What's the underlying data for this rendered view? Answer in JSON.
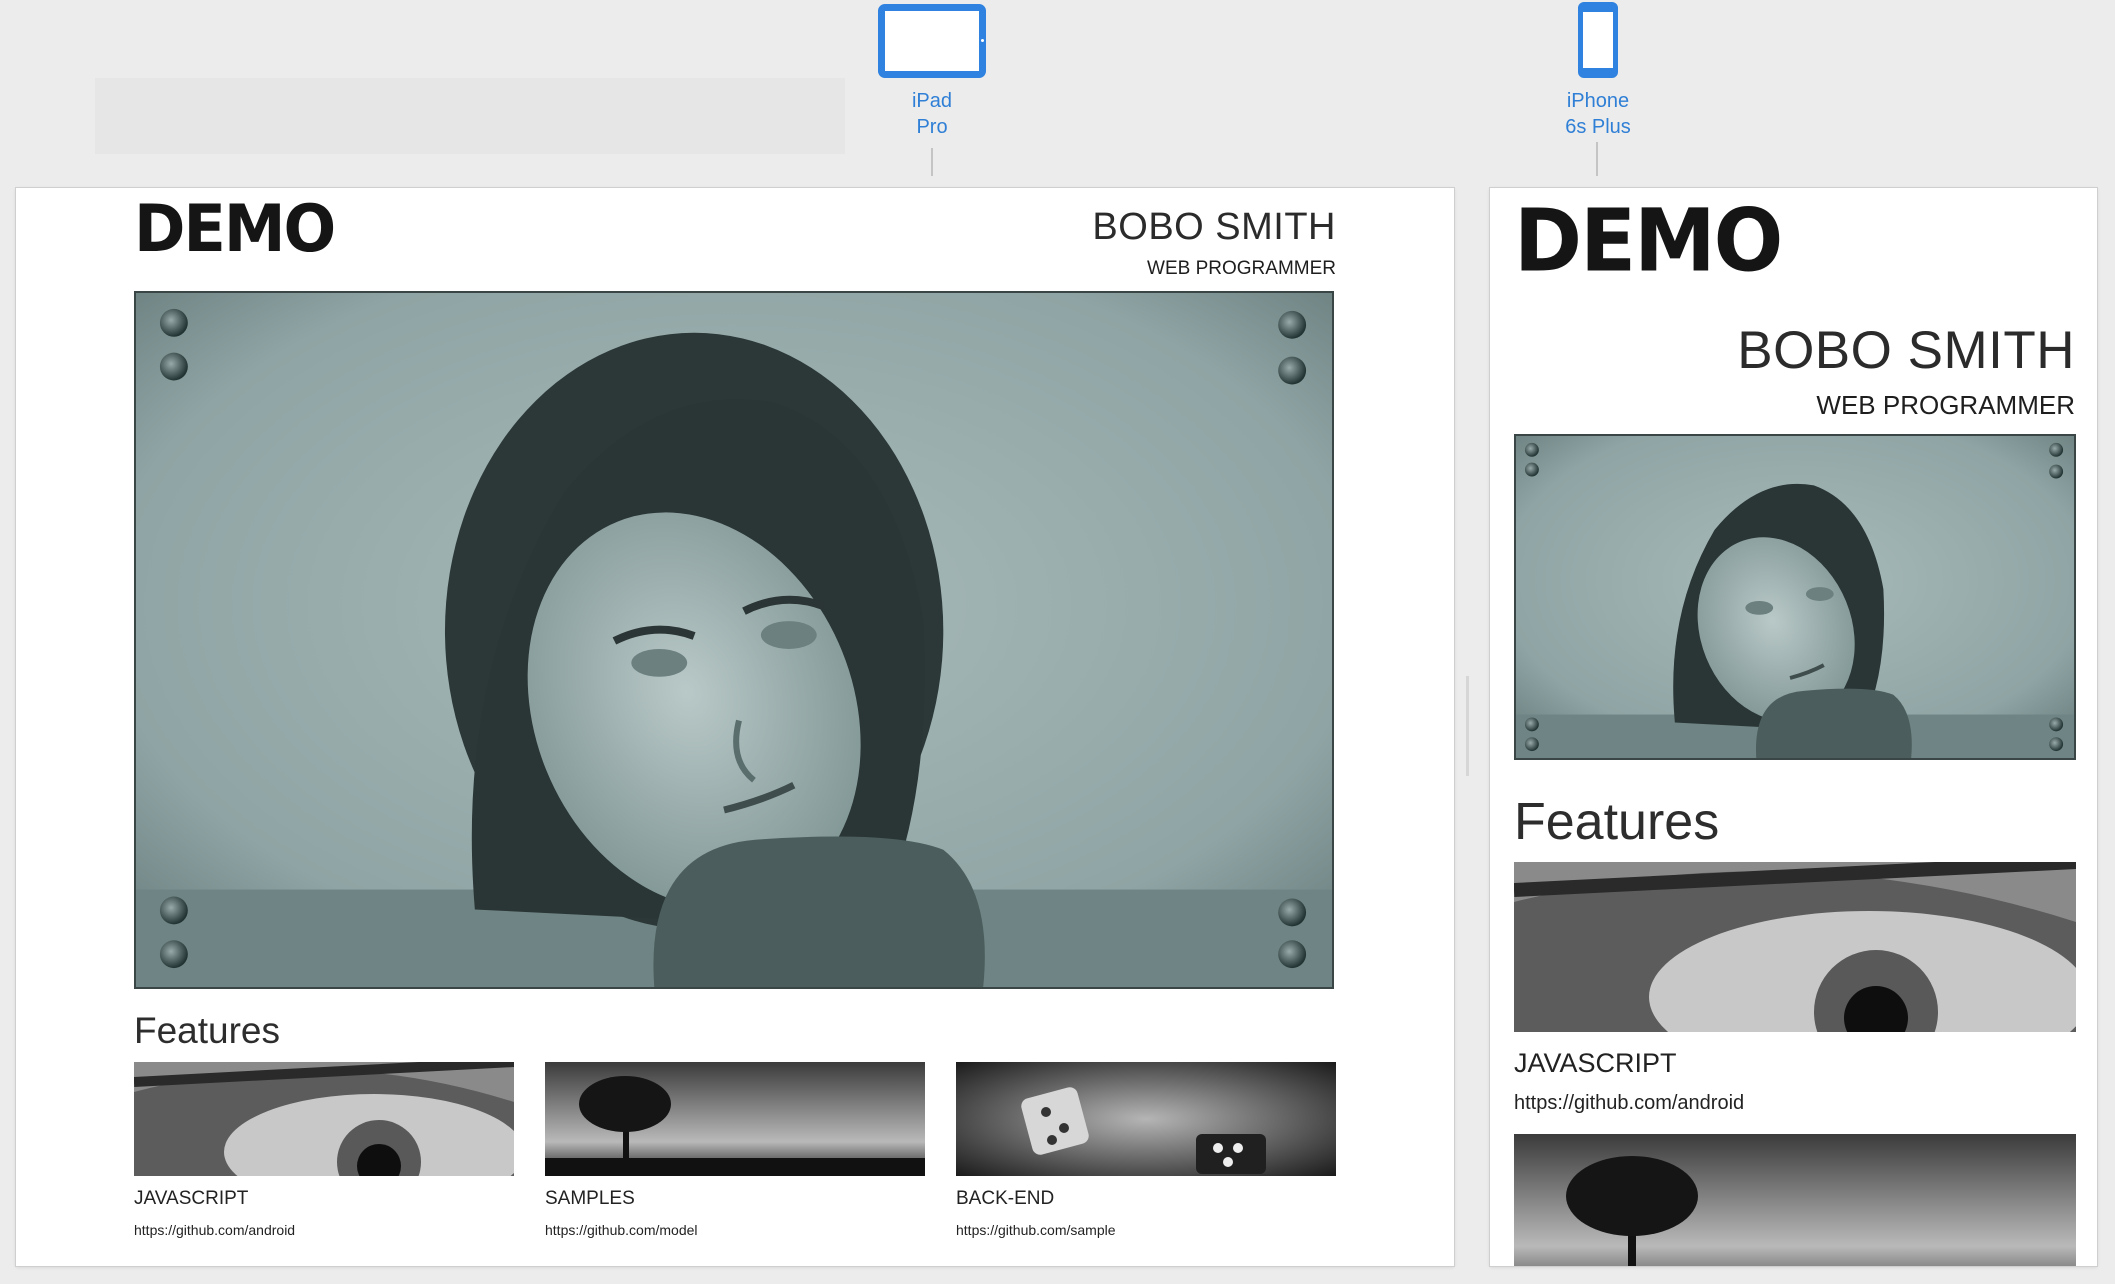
{
  "devices": [
    {
      "name_line1": "iPad",
      "name_line2": "Pro",
      "icon": "tablet-icon"
    },
    {
      "name_line1": "iPhone",
      "name_line2": "6s Plus",
      "icon": "phone-icon"
    }
  ],
  "site": {
    "logo": "DEMO",
    "name": "BOBO SMITH",
    "role": "WEB PROGRAMMER",
    "features_heading": "Features",
    "features": [
      {
        "title": "JAVASCRIPT",
        "link": "https://github.com/android",
        "image": "eye-photo"
      },
      {
        "title": "SAMPLES",
        "link": "https://github.com/model",
        "image": "tree-photo"
      },
      {
        "title": "BACK-END",
        "link": "https://github.com/sample",
        "image": "dice-photo"
      }
    ]
  },
  "colors": {
    "accent": "#2f82e0",
    "hero_tint": "#8fa5a5"
  }
}
